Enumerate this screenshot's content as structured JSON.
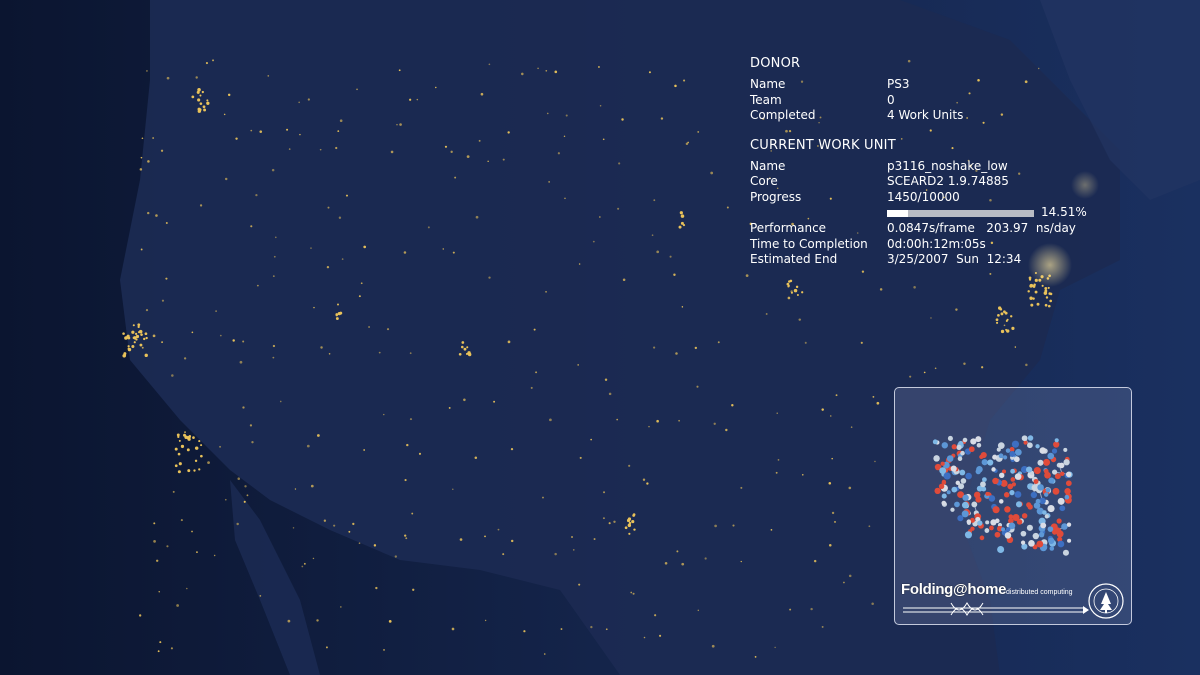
{
  "donor": {
    "title": "DONOR",
    "rows": [
      {
        "label": "Name",
        "value": "PS3"
      },
      {
        "label": "Team",
        "value": "0"
      },
      {
        "label": "Completed",
        "value": "4 Work Units"
      }
    ]
  },
  "work_unit": {
    "title": "CURRENT WORK UNIT",
    "name": {
      "label": "Name",
      "value": "p3116_noshake_low"
    },
    "core": {
      "label": "Core",
      "value": "SCEARD2 1.9.74885"
    },
    "progress": {
      "label": "Progress",
      "value": "1450/10000",
      "percent_text": "14.51%",
      "fraction": 0.1451
    },
    "performance": {
      "label": "Performance",
      "value": "0.0847s/frame   203.97  ns/day"
    },
    "time_to_completion": {
      "label": "Time to Completion",
      "value": "0d:00h:12m:05s"
    },
    "estimated_end": {
      "label": "Estimated End",
      "value": "3/25/2007  Sun  12:34"
    }
  },
  "logo": {
    "brand": "Folding@home",
    "tagline": "distributed computing",
    "seal_icon": "stanford-seal-icon"
  },
  "colors": {
    "background": "#0e1a35",
    "city_lights": "#e9c25a",
    "progress_fill": "#ffffff",
    "progress_track": "#b9bcc4"
  }
}
